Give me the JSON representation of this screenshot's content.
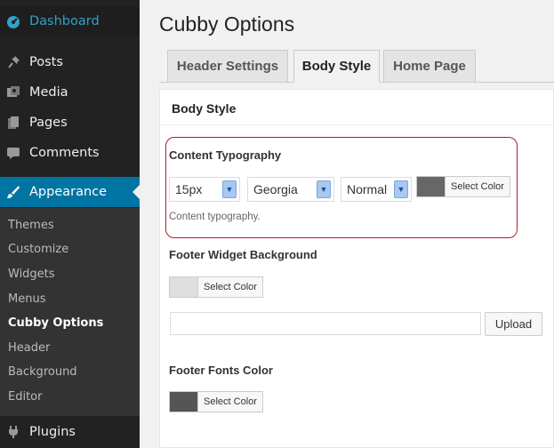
{
  "sidebar": {
    "menu": [
      {
        "label": "Dashboard",
        "icon": "dashboard-icon"
      },
      {
        "label": "Posts",
        "icon": "pin-icon"
      },
      {
        "label": "Media",
        "icon": "media-icon"
      },
      {
        "label": "Pages",
        "icon": "pages-icon"
      },
      {
        "label": "Comments",
        "icon": "comment-icon"
      },
      {
        "label": "Appearance",
        "icon": "brush-icon"
      },
      {
        "label": "Plugins",
        "icon": "plug-icon"
      }
    ],
    "submenu": [
      "Themes",
      "Customize",
      "Widgets",
      "Menus",
      "Cubby Options",
      "Header",
      "Background",
      "Editor"
    ]
  },
  "page": {
    "title": "Cubby Options",
    "tabs": [
      "Header Settings",
      "Body Style",
      "Home Page"
    ],
    "active_tab": "Body Style"
  },
  "panel": {
    "title": "Body Style",
    "content_typography": {
      "label": "Content Typography",
      "size": "15px",
      "font": "Georgia",
      "weight": "Normal",
      "color_button": "Select Color",
      "color": "#676767",
      "description": "Content typography."
    },
    "footer_widget_bg": {
      "label": "Footer Widget Background",
      "color_button": "Select Color",
      "color": "#dedede",
      "upload_value": "",
      "upload_button": "Upload"
    },
    "footer_fonts_color": {
      "label": "Footer Fonts Color",
      "color_button": "Select Color",
      "color": "#555555"
    }
  },
  "colors": {
    "accent": "#0074a2",
    "highlight_border": "#b41b2a"
  }
}
